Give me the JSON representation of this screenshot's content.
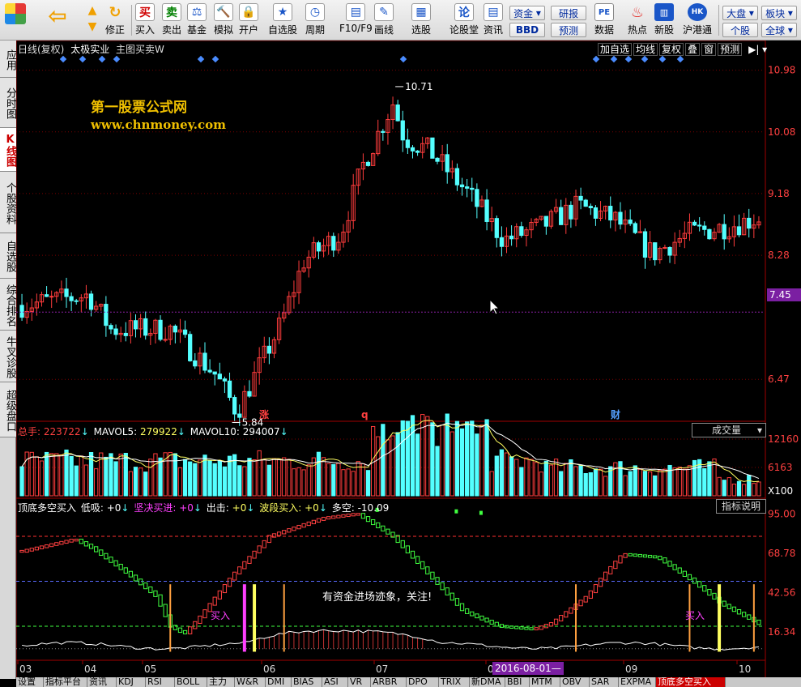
{
  "toolbar": {
    "buttons": [
      {
        "id": "buy",
        "label": "买入",
        "icon": "买",
        "color": "#d00000"
      },
      {
        "id": "sell",
        "label": "卖出",
        "icon": "卖",
        "color": "#008000"
      },
      {
        "id": "fund",
        "label": "基金",
        "icon": "⚖",
        "color": "#1a56c8"
      },
      {
        "id": "sim",
        "label": "模拟",
        "icon": "🔨",
        "color": "#a05000"
      },
      {
        "id": "open",
        "label": "开户",
        "icon": "🔒",
        "color": "#c07000"
      },
      {
        "id": "watch",
        "label": "自选股",
        "icon": "★",
        "color": "#1a56c8"
      },
      {
        "id": "period",
        "label": "周期",
        "icon": "◷",
        "color": "#1a56c8"
      },
      {
        "id": "f10",
        "label": "F10/F9",
        "icon": "▤",
        "color": "#1a56c8"
      },
      {
        "id": "draw",
        "label": "画线",
        "icon": "✎",
        "color": "#1a56c8"
      },
      {
        "id": "pick",
        "label": "选股",
        "icon": "▦",
        "color": "#1a56c8"
      },
      {
        "id": "forum",
        "label": "论股堂",
        "icon": "论",
        "color": "#1a56c8"
      },
      {
        "id": "news",
        "label": "资讯",
        "icon": "▤",
        "color": "#1a56c8"
      }
    ],
    "nav": {
      "up": "▲",
      "down": "▼",
      "fix": "修正"
    },
    "small": {
      "capital": "资金",
      "bbd": "BBD",
      "research": "研报",
      "forecast": "预测",
      "data": "数据",
      "hot": "热点",
      "newstock": "新股",
      "hkconnect": "沪港通",
      "market": "大盘",
      "sector": "板块",
      "single": "个股",
      "all": "全球"
    }
  },
  "left_tabs": [
    "应用",
    "分时图",
    "K线图",
    "个股资料",
    "自选股",
    "综合排名",
    "牛叉诊股",
    "超级盘口"
  ],
  "main_header": {
    "period": "日线(复权)",
    "stock": "太极实业",
    "formula": "主图买卖W",
    "right": [
      "加自选",
      "均线",
      "复权",
      "叠",
      "窗",
      "预测"
    ]
  },
  "watermark": {
    "line1": "第一股票公式网",
    "line2": "www.chnmoney.com"
  },
  "price_axis": [
    "10.98",
    "10.08",
    "9.18",
    "8.28",
    "7.45",
    "6.47"
  ],
  "current_price": "7.45",
  "price_marks": {
    "high": "10.71",
    "low": "5.84"
  },
  "event_marks": [
    {
      "label": "涨"
    },
    {
      "label": "q"
    },
    {
      "label": "财"
    }
  ],
  "volume": {
    "label_total": "总手:",
    "total": "223722",
    "arrow": "↓",
    "mavol5_label": "MAVOL5:",
    "mavol5": "279922",
    "mavol10_label": "MAVOL10:",
    "mavol10": "294007",
    "selector": "成交量",
    "axis": [
      "12160",
      "6163",
      "X100"
    ]
  },
  "indicator": {
    "name": "顶底多空买入",
    "low_label": "低吸:",
    "low": "+0",
    "firm_label": "坚决买进:",
    "firm": "+0",
    "out_label": "出击:",
    "out": "+0",
    "wave_label": "波段买入:",
    "wave": "+0",
    "ls_label": "多空:",
    "ls": "-10.09",
    "explain": "指标说明",
    "axis": [
      "95.00",
      "68.78",
      "42.56",
      "16.34"
    ],
    "note": "有资金进场迹象，关注!",
    "buy1": "买入",
    "buy2": "买入"
  },
  "date_axis": [
    "03",
    "04",
    "05",
    "06",
    "07",
    "08",
    "09",
    "10"
  ],
  "date_cursor": "2016-08-01",
  "bottom_tabs": [
    "设置",
    "指标平台",
    "资讯",
    "KDJ",
    "RSI",
    "BOLL",
    "主力",
    "W&R",
    "DMI",
    "BIAS",
    "ASI",
    "VR",
    "ARBR",
    "DPO",
    "TRIX",
    "新DMA",
    "BBI",
    "MTM",
    "OBV",
    "SAR",
    "EXPMA",
    "顶底多空买入"
  ],
  "colors": {
    "up": "#ff3c3c",
    "down": "#54ffff",
    "accent": "#7b1fa2",
    "grid": "#7a0000"
  }
}
